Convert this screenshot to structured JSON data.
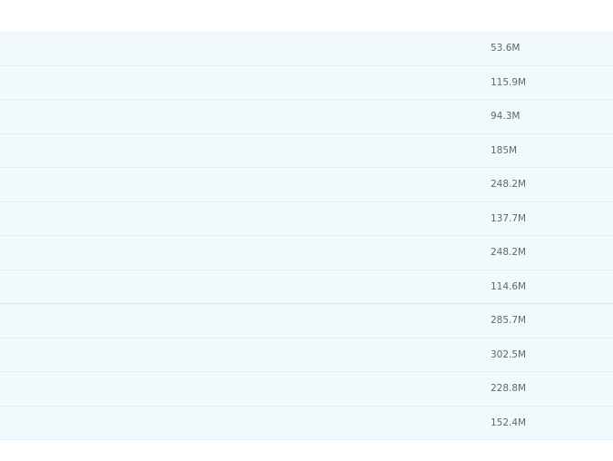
{
  "table": {
    "rows": [
      {
        "size": "53.6M"
      },
      {
        "size": "115.9M"
      },
      {
        "size": "94.3M"
      },
      {
        "size": "185M"
      },
      {
        "size": "248.2M"
      },
      {
        "size": "137.7M"
      },
      {
        "size": "248.2M"
      },
      {
        "size": "114.6M"
      },
      {
        "size": "285.7M"
      },
      {
        "size": "302.5M"
      },
      {
        "size": "228.8M"
      },
      {
        "size": "152.4M"
      }
    ]
  }
}
